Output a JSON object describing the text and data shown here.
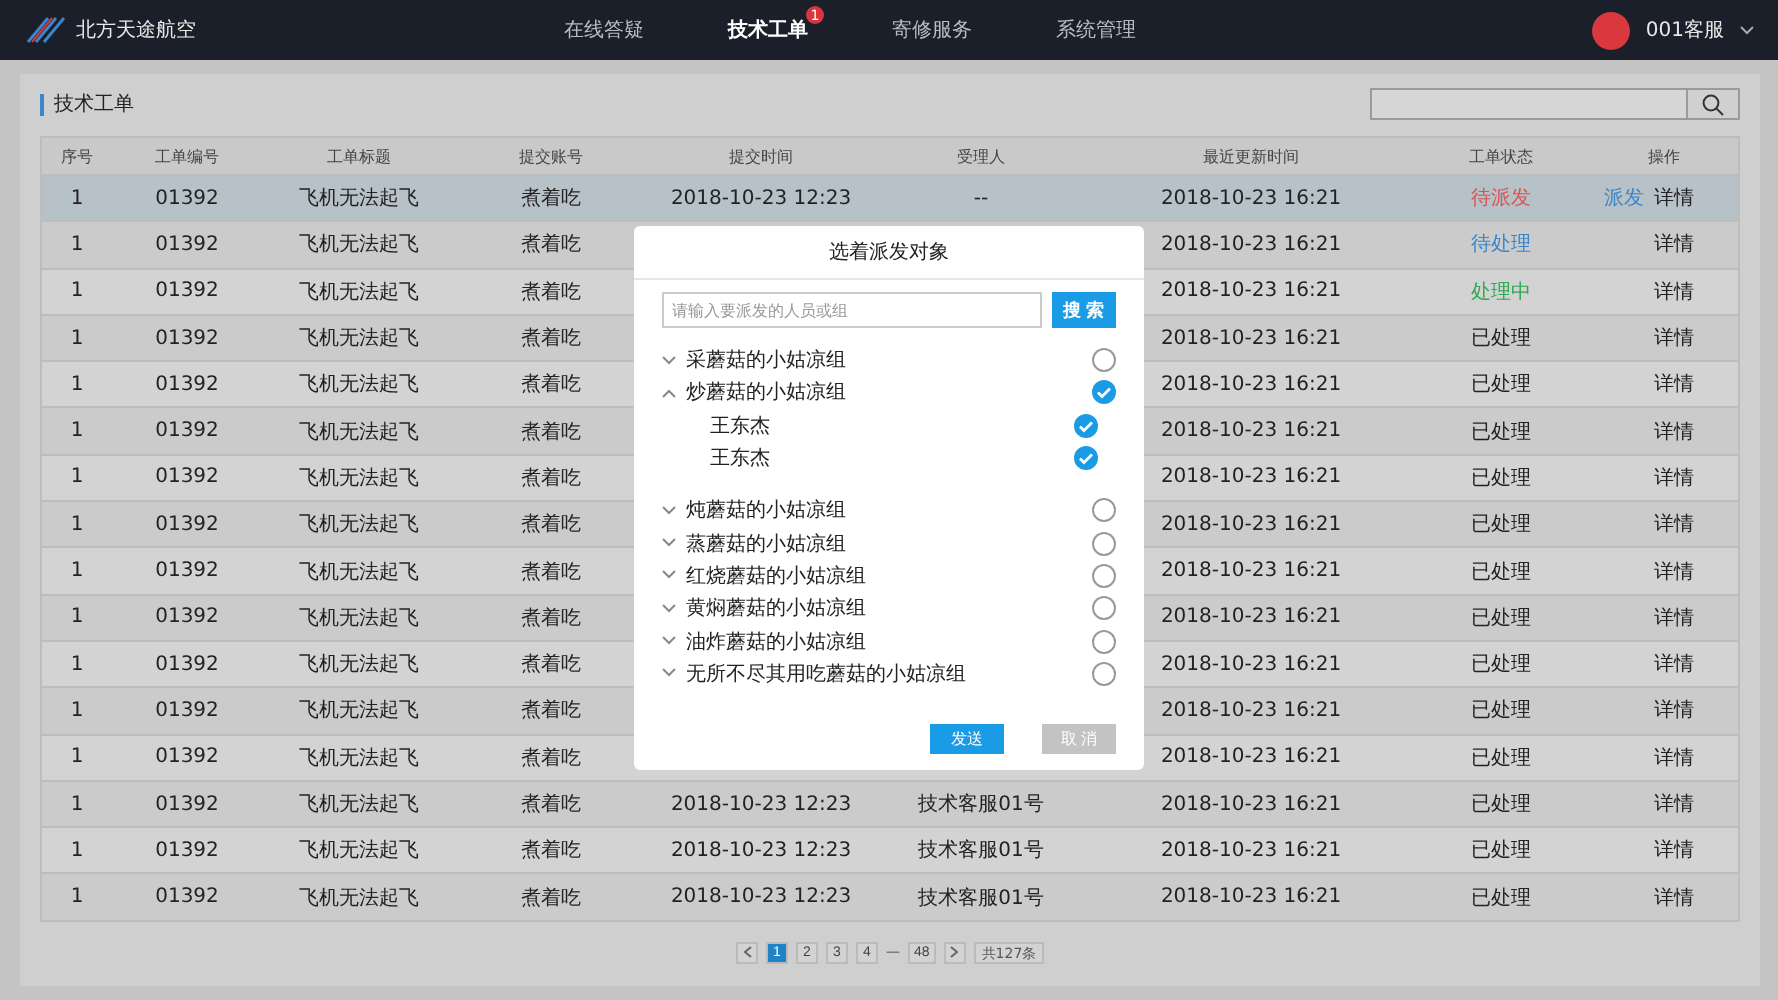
{
  "brand": {
    "name": "北方天途航空"
  },
  "nav": [
    {
      "label": "在线答疑",
      "selected": false
    },
    {
      "label": "技术工单",
      "selected": true,
      "badge": "1"
    },
    {
      "label": "寄修服务",
      "selected": false
    },
    {
      "label": "系统管理",
      "selected": false
    }
  ],
  "user": {
    "name": "001客服"
  },
  "page_title": "技术工单",
  "table": {
    "columns": [
      "序号",
      "工单编号",
      "工单标题",
      "提交账号",
      "提交时间",
      "受理人",
      "最近更新时间",
      "工单状态",
      "操作"
    ],
    "rows": [
      {
        "selected": true,
        "no": "1",
        "id": "01392",
        "title": "飞机无法起飞",
        "account": "煮着吃",
        "submit_time": "2018-10-23 12:23",
        "assignee": "--",
        "updated": "2018-10-23 16:21",
        "status": "待派发",
        "color": "#d9534f",
        "actions": [
          "派发",
          "详情"
        ]
      },
      {
        "selected": false,
        "no": "1",
        "id": "01392",
        "title": "飞机无法起飞",
        "account": "煮着吃",
        "updated": "2018-10-23 16:21",
        "status": "待处理",
        "color": "#3a86c8",
        "actions": [
          "详情"
        ]
      },
      {
        "selected": false,
        "no": "1",
        "id": "01392",
        "title": "飞机无法起飞",
        "account": "煮着吃",
        "updated": "2018-10-23 16:21",
        "status": "处理中",
        "color": "#2fa84f",
        "actions": [
          "详情"
        ]
      },
      {
        "selected": false,
        "no": "1",
        "id": "01392",
        "title": "飞机无法起飞",
        "account": "煮着吃",
        "updated": "2018-10-23 16:21",
        "status": "已处理",
        "color": "#222222",
        "actions": [
          "详情"
        ]
      },
      {
        "selected": false,
        "no": "1",
        "id": "01392",
        "title": "飞机无法起飞",
        "account": "煮着吃",
        "updated": "2018-10-23 16:21",
        "status": "已处理",
        "color": "#222222",
        "actions": [
          "详情"
        ]
      },
      {
        "selected": false,
        "no": "1",
        "id": "01392",
        "title": "飞机无法起飞",
        "account": "煮着吃",
        "updated": "2018-10-23 16:21",
        "status": "已处理",
        "color": "#222222",
        "actions": [
          "详情"
        ]
      },
      {
        "selected": false,
        "no": "1",
        "id": "01392",
        "title": "飞机无法起飞",
        "account": "煮着吃",
        "updated": "2018-10-23 16:21",
        "status": "已处理",
        "color": "#222222",
        "actions": [
          "详情"
        ]
      },
      {
        "selected": false,
        "no": "1",
        "id": "01392",
        "title": "飞机无法起飞",
        "account": "煮着吃",
        "updated": "2018-10-23 16:21",
        "status": "已处理",
        "color": "#222222",
        "actions": [
          "详情"
        ]
      },
      {
        "selected": false,
        "no": "1",
        "id": "01392",
        "title": "飞机无法起飞",
        "account": "煮着吃",
        "updated": "2018-10-23 16:21",
        "status": "已处理",
        "color": "#222222",
        "actions": [
          "详情"
        ]
      },
      {
        "selected": false,
        "no": "1",
        "id": "01392",
        "title": "飞机无法起飞",
        "account": "煮着吃",
        "updated": "2018-10-23 16:21",
        "status": "已处理",
        "color": "#222222",
        "actions": [
          "详情"
        ]
      },
      {
        "selected": false,
        "no": "1",
        "id": "01392",
        "title": "飞机无法起飞",
        "account": "煮着吃",
        "updated": "2018-10-23 16:21",
        "status": "已处理",
        "color": "#222222",
        "actions": [
          "详情"
        ]
      },
      {
        "selected": false,
        "no": "1",
        "id": "01392",
        "title": "飞机无法起飞",
        "account": "煮着吃",
        "updated": "2018-10-23 16:21",
        "status": "已处理",
        "color": "#222222",
        "actions": [
          "详情"
        ]
      },
      {
        "selected": false,
        "no": "1",
        "id": "01392",
        "title": "飞机无法起飞",
        "account": "煮着吃",
        "updated": "2018-10-23 16:21",
        "status": "已处理",
        "color": "#222222",
        "actions": [
          "详情"
        ]
      },
      {
        "selected": false,
        "no": "1",
        "id": "01392",
        "title": "飞机无法起飞",
        "account": "煮着吃",
        "submit_time": "2018-10-23 12:23",
        "assignee": "技术客服01号",
        "updated": "2018-10-23 16:21",
        "status": "已处理",
        "color": "#222222",
        "actions": [
          "详情"
        ]
      },
      {
        "selected": false,
        "no": "1",
        "id": "01392",
        "title": "飞机无法起飞",
        "account": "煮着吃",
        "submit_time": "2018-10-23 12:23",
        "assignee": "技术客服01号",
        "updated": "2018-10-23 16:21",
        "status": "已处理",
        "color": "#222222",
        "actions": [
          "详情"
        ]
      },
      {
        "selected": false,
        "no": "1",
        "id": "01392",
        "title": "飞机无法起飞",
        "account": "煮着吃",
        "submit_time": "2018-10-23 12:23",
        "assignee": "技术客服01号",
        "updated": "2018-10-23 16:21",
        "status": "已处理",
        "color": "#222222",
        "actions": [
          "详情"
        ]
      }
    ]
  },
  "pagination": {
    "pages": [
      {
        "label": "1",
        "selected": true
      },
      {
        "label": "2",
        "selected": false
      },
      {
        "label": "3",
        "selected": false
      },
      {
        "label": "4",
        "selected": false
      }
    ],
    "ellipsis": "—",
    "last": "48",
    "total": "共127条"
  },
  "dialog": {
    "title": "选着派发对象",
    "search": {
      "placeholder": "请输入要派发的人员或组",
      "button": "搜 索"
    },
    "groups": [
      {
        "name": "采蘑菇的小姑凉组",
        "expanded": false,
        "checked": false
      },
      {
        "name": "炒蘑菇的小姑凉组",
        "expanded": true,
        "checked": true,
        "children": [
          {
            "name": "王东杰",
            "checked": true
          },
          {
            "name": "王东杰",
            "checked": true
          }
        ]
      },
      {
        "name": "炖蘑菇的小姑凉组",
        "expanded": false,
        "checked": false
      },
      {
        "name": "蒸蘑菇的小姑凉组",
        "expanded": false,
        "checked": false
      },
      {
        "name": "红烧蘑菇的小姑凉组",
        "expanded": false,
        "checked": false
      },
      {
        "name": "黄焖蘑菇的小姑凉组",
        "expanded": false,
        "checked": false
      },
      {
        "name": "油炸蘑菇的小姑凉组",
        "expanded": false,
        "checked": false
      },
      {
        "name": "无所不尽其用吃蘑菇的小姑凉组",
        "expanded": false,
        "checked": false
      }
    ],
    "buttons": [
      {
        "label": "发送",
        "disabled": false
      },
      {
        "label": "取 消",
        "disabled": true
      }
    ]
  }
}
